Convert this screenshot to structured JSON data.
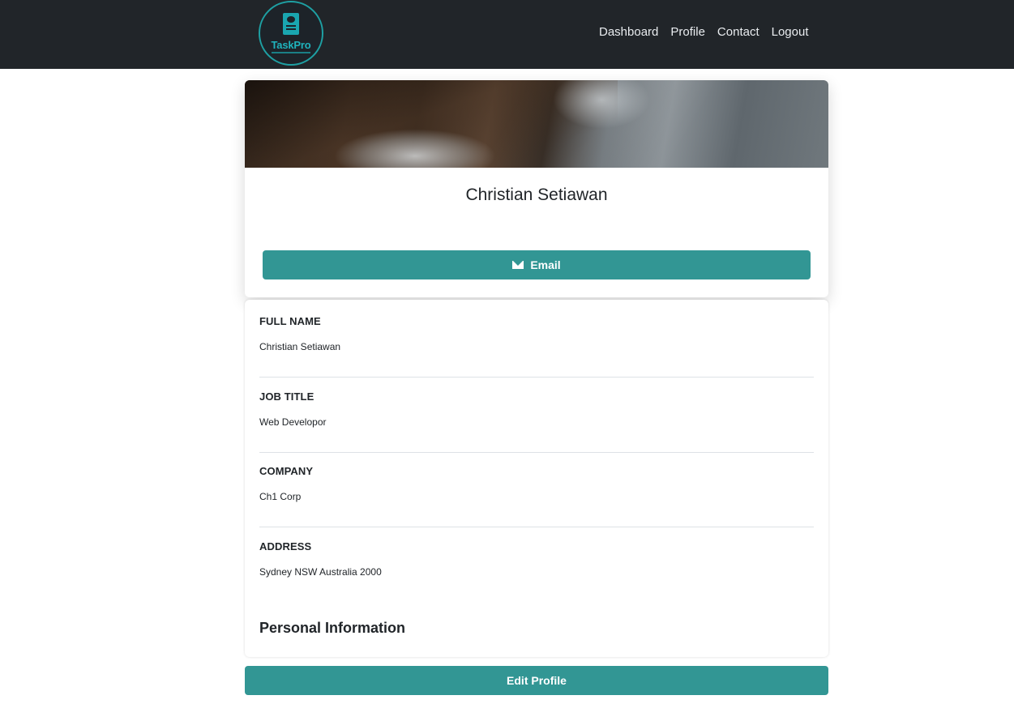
{
  "brand": {
    "logo_text": "TaskPro",
    "logo_icon": "document-icon"
  },
  "nav": {
    "items": [
      {
        "label": "Dashboard"
      },
      {
        "label": "Profile"
      },
      {
        "label": "Contact"
      },
      {
        "label": "Logout"
      }
    ]
  },
  "profile": {
    "name": "Christian Setiawan",
    "email_button": {
      "label": "Email",
      "icon": "envelope-icon"
    }
  },
  "details": [
    {
      "label": "FULL NAME",
      "value": "Christian Setiawan"
    },
    {
      "label": "JOB TITLE",
      "value": "Web Developor"
    },
    {
      "label": "COMPANY",
      "value": "Ch1 Corp"
    },
    {
      "label": "ADDRESS",
      "value": "Sydney NSW Australia 2000"
    }
  ],
  "section_title": "Personal Information",
  "edit_button": {
    "label": "Edit Profile"
  },
  "colors": {
    "navbar_bg": "#212529",
    "accent": "#329694",
    "logo_ring": "#1ea0a3"
  }
}
